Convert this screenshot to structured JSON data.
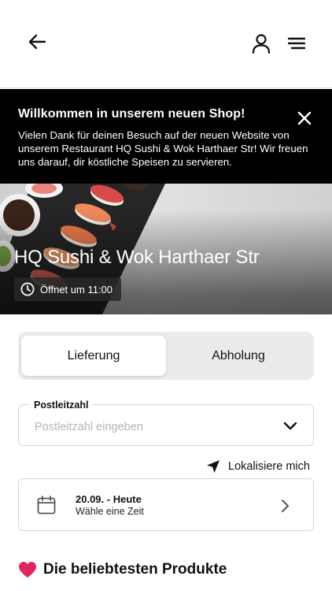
{
  "header": {
    "back_icon": "arrow-left-icon",
    "account_icon": "user-icon",
    "menu_icon": "hamburger-menu-icon"
  },
  "banner": {
    "title": "Willkommen in unserem neuen Shop!",
    "text": "Vielen Dank für deinen Besuch auf der neuen Website von unserem Restaurant HQ Sushi & Wok Harthaer Str! Wir freuen uns darauf, dir köstliche Speisen zu servieren.",
    "close_icon": "close-icon"
  },
  "hero": {
    "restaurant_name": "HQ Sushi & Wok Harthaer Str",
    "opening_text": "Öffnet um 11:00",
    "clock_icon": "clock-icon"
  },
  "order_type": {
    "options": [
      "Lieferung",
      "Abholung"
    ],
    "selected": "Lieferung"
  },
  "postcode": {
    "label": "Postleitzahl",
    "placeholder": "Postleitzahl eingeben",
    "value": ""
  },
  "locate": {
    "label": "Lokalisiere mich",
    "icon": "location-arrow-icon"
  },
  "time_slot": {
    "date": "20.09. - Heute",
    "subtitle": "Wähle eine Zeit",
    "icon": "calendar-icon"
  },
  "popular_section": {
    "emoji": "❤️",
    "title": "Die beliebtesten Produkte"
  },
  "colors": {
    "banner_bg": "#000000",
    "toggle_bg": "#ebebeb",
    "border": "#d6d6d6",
    "heart": "#e0245e"
  }
}
